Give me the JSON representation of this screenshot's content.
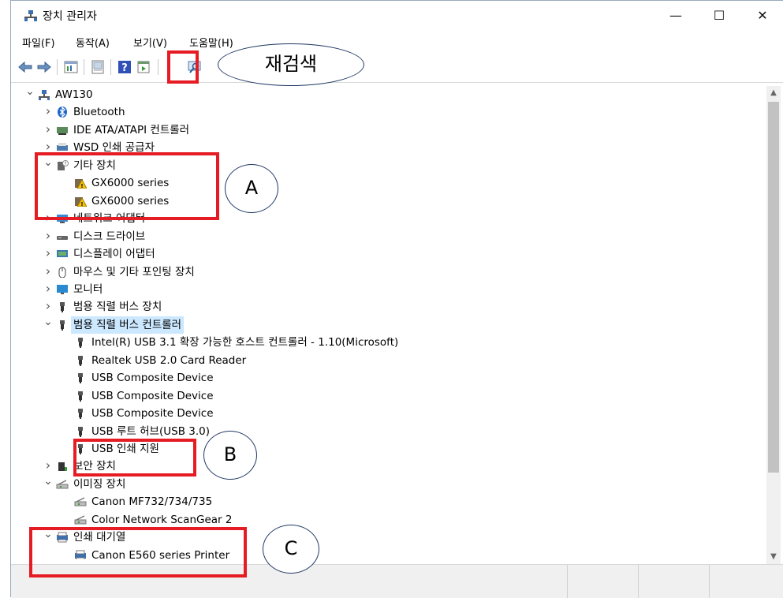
{
  "window": {
    "title": "장치 관리자",
    "controls": {
      "minimize": "—",
      "maximize": "☐",
      "close": "✕"
    }
  },
  "menu": {
    "items": [
      "파일(F)",
      "동작(A)",
      "보기(V)",
      "도움말(H)"
    ]
  },
  "toolbar": {
    "icons": [
      "back-icon",
      "forward-icon",
      "properties-icon",
      "device-icon",
      "help-icon",
      "view-icon",
      "scan-hardware-icon"
    ]
  },
  "tree": {
    "root": "AW130",
    "rows": [
      {
        "label": "AW130",
        "level": 0,
        "expanded": true,
        "icon": "computer-icon"
      },
      {
        "label": "Bluetooth",
        "level": 1,
        "expanded": false,
        "icon": "bluetooth-icon"
      },
      {
        "label": "IDE ATA/ATAPI 컨트롤러",
        "level": 1,
        "expanded": false,
        "icon": "ide-controller-icon"
      },
      {
        "label": "WSD 인쇄 공급자",
        "level": 1,
        "expanded": false,
        "icon": "wsd-printer-icon"
      },
      {
        "label": "기타 장치",
        "level": 1,
        "expanded": true,
        "icon": "unknown-device-icon"
      },
      {
        "label": "GX6000 series",
        "level": 2,
        "icon": "warning-device-icon"
      },
      {
        "label": "GX6000 series",
        "level": 2,
        "icon": "warning-device-icon"
      },
      {
        "label": "네트워크 어댑터",
        "level": 1,
        "expanded": false,
        "icon": "network-adapter-icon"
      },
      {
        "label": "디스크 드라이브",
        "level": 1,
        "expanded": false,
        "icon": "disk-drive-icon"
      },
      {
        "label": "디스플레이 어댑터",
        "level": 1,
        "expanded": false,
        "icon": "display-adapter-icon"
      },
      {
        "label": "마우스 및 기타 포인팅 장치",
        "level": 1,
        "expanded": false,
        "icon": "mouse-icon"
      },
      {
        "label": "모니터",
        "level": 1,
        "expanded": false,
        "icon": "monitor-icon"
      },
      {
        "label": "범용 직렬 버스 장치",
        "level": 1,
        "expanded": false,
        "icon": "usb-icon"
      },
      {
        "label": "범용 직렬 버스 컨트롤러",
        "level": 1,
        "expanded": true,
        "icon": "usb-icon",
        "selected": true
      },
      {
        "label": "Intel(R) USB 3.1 확장 가능한 호스트 컨트롤러 - 1.10(Microsoft)",
        "level": 2,
        "icon": "usb-icon"
      },
      {
        "label": "Realtek USB 2.0 Card Reader",
        "level": 2,
        "icon": "usb-icon"
      },
      {
        "label": "USB Composite Device",
        "level": 2,
        "icon": "usb-icon"
      },
      {
        "label": "USB Composite Device",
        "level": 2,
        "icon": "usb-icon"
      },
      {
        "label": "USB Composite Device",
        "level": 2,
        "icon": "usb-icon"
      },
      {
        "label": "USB 루트 허브(USB 3.0)",
        "level": 2,
        "icon": "usb-icon"
      },
      {
        "label": "USB 인쇄 지원",
        "level": 2,
        "icon": "usb-icon"
      },
      {
        "label": "보안 장치",
        "level": 1,
        "expanded": false,
        "icon": "security-device-icon"
      },
      {
        "label": "이미징 장치",
        "level": 1,
        "expanded": true,
        "icon": "imaging-device-icon"
      },
      {
        "label": "Canon MF732/734/735",
        "level": 2,
        "icon": "imaging-device-icon"
      },
      {
        "label": "Color Network ScanGear 2",
        "level": 2,
        "icon": "imaging-device-icon"
      },
      {
        "label": "인쇄 대기열",
        "level": 1,
        "expanded": true,
        "icon": "print-queue-icon"
      },
      {
        "label": "Canon E560 series Printer",
        "level": 2,
        "icon": "printer-icon"
      }
    ]
  },
  "annotations": {
    "rescan_label": "재검색",
    "callout_a": "A",
    "callout_b": "B",
    "callout_c": "C"
  },
  "colors": {
    "highlight": "#e51c23",
    "selection": "#cce8ff",
    "callout_border": "#1f3864"
  }
}
